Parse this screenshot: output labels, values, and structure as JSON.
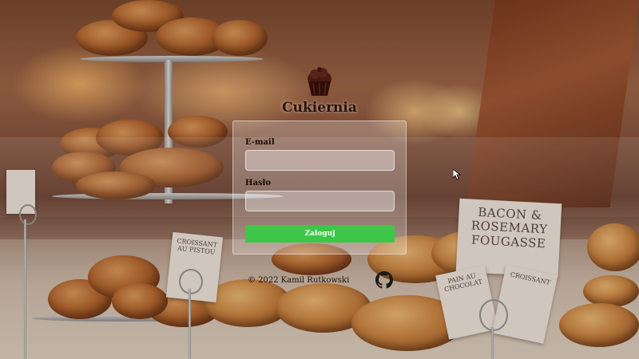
{
  "brand": {
    "title": "Cukiernia",
    "logo_icon": "cupcake-icon"
  },
  "form": {
    "email_label": "E-mail",
    "email_value": "",
    "password_label": "Hasło",
    "password_value": "",
    "submit_label": "Zaloguj"
  },
  "footer": {
    "copyright": "© 2022 Kamil Rutkowski",
    "github_icon": "github-icon"
  },
  "background": {
    "signs": [
      "BACON & ROSEMARY FOUGASSE",
      "CROISSANT AU PISTOU",
      "PAIN AU CHOCOLAT",
      "CROISSANT"
    ]
  },
  "colors": {
    "submit": "#3ec64a",
    "card": "rgba(255,255,255,0.25)"
  }
}
